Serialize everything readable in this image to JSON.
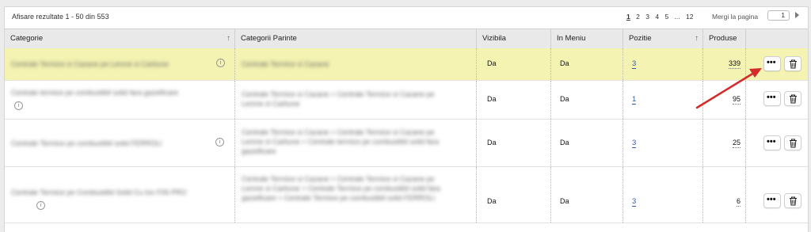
{
  "summary": "Afisare rezultate 1 - 50 din 553",
  "pagination": {
    "pages": [
      "1",
      "2",
      "3",
      "4",
      "5",
      "...",
      "12"
    ],
    "goto_label": "Mergi la pagina",
    "goto_value": "1"
  },
  "columns": {
    "categorie": "Categorie",
    "parinte": "Categorii Parinte",
    "vizibila": "Vizibila",
    "meniu": "In Meniu",
    "pozitie": "Pozitie",
    "produse": "Produse"
  },
  "rows": [
    {
      "categorie": "Centrale Termice si Cazane pe Lemne si Carbune",
      "parinte": "Centrale Termice si Cazane",
      "vizibila": "Da",
      "meniu": "Da",
      "pozitie": "3",
      "produse": "339"
    },
    {
      "categorie": "Centrale termice pe combustibil solid fara gazeificare",
      "parinte": "Centrale Termice si Cazane > Centrale Termice si Cazane pe Lemne si Carbune",
      "vizibila": "Da",
      "meniu": "Da",
      "pozitie": "1",
      "produse": "95"
    },
    {
      "categorie": "Centrale Termice pe combustibil solid FERROLI",
      "parinte": "Centrale Termice si Cazane > Centrale Termice si Cazane pe Lemne si Carbune > Centrale termice pe combustibil solid fara gazeificare",
      "vizibila": "Da",
      "meniu": "Da",
      "pozitie": "3",
      "produse": "25"
    },
    {
      "categorie": "Centrale Termice pe Combustibil Solid Cu Ion F06 PRO",
      "parinte": "Centrale Termice si Cazane > Centrale Termice si Cazane pe Lemne si Carbune > Centrale Termice pe combustibil solid fara gazeificare > Centrale Termice pe combustibil solid FERROLI",
      "vizibila": "Da",
      "meniu": "Da",
      "pozitie": "3",
      "produse": "6"
    }
  ],
  "icons": {
    "more": "more-options-icon",
    "delete": "trash-icon",
    "info": "info-icon",
    "sort": "sort-arrow-icon"
  },
  "colors": {
    "highlight_row": "#f4f3b2",
    "link": "#2f5aa6",
    "annotation_arrow": "#d42a2a"
  }
}
